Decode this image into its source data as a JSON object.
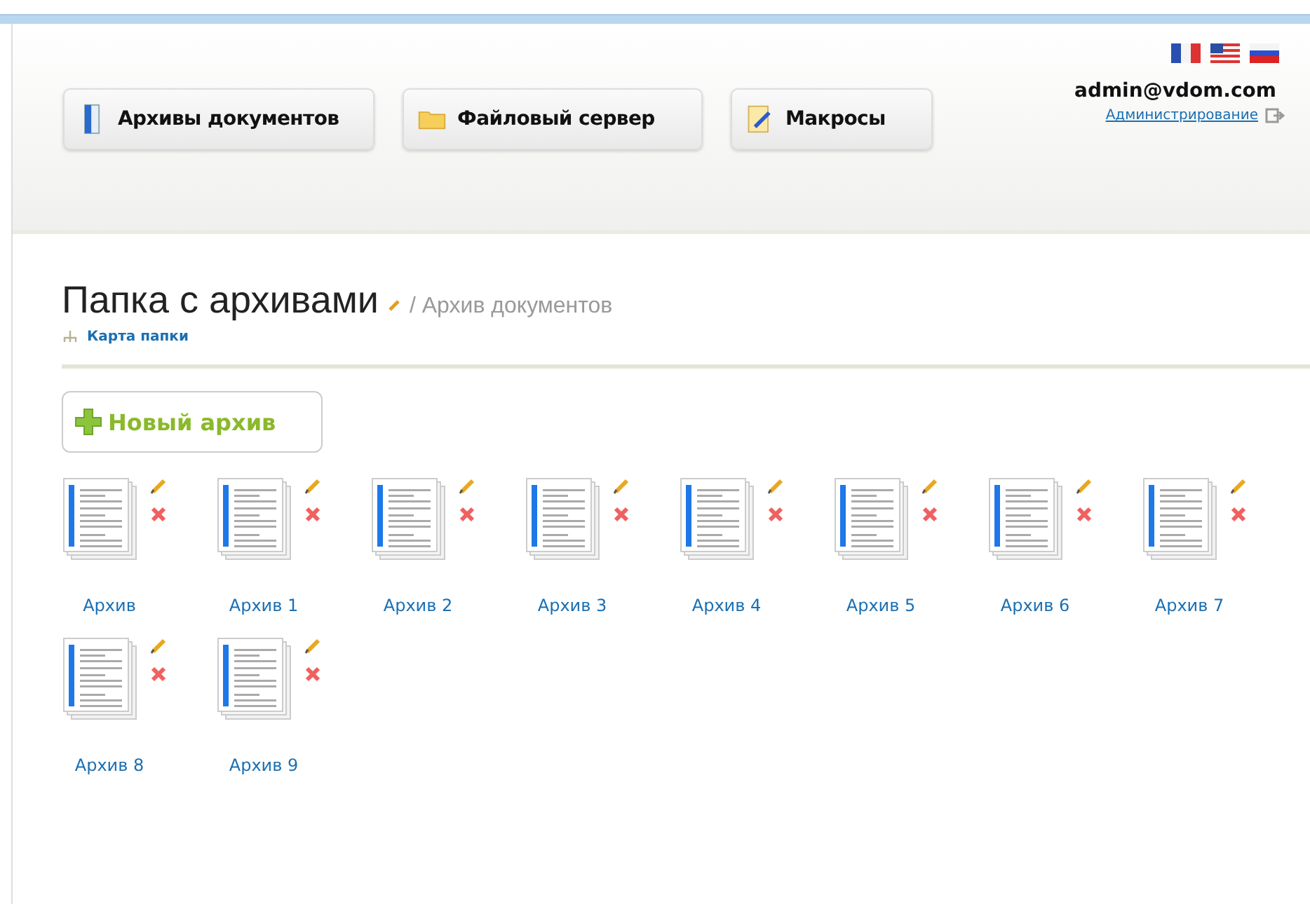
{
  "nav": [
    {
      "label": "Архивы документов",
      "kind": "book"
    },
    {
      "label": "Файловый сервер",
      "kind": "folder"
    },
    {
      "label": "Макросы",
      "kind": "note"
    }
  ],
  "user": {
    "email": "admin@vdom.com",
    "admin_link": "Администрирование"
  },
  "page": {
    "title": "Папка с архивами",
    "breadcrumb": "/ Архив документов",
    "map_link": "Карта папки",
    "new_button": "Новый архив"
  },
  "archives": [
    {
      "label": "Архив"
    },
    {
      "label": "Архив 1"
    },
    {
      "label": "Архив 2"
    },
    {
      "label": "Архив 3"
    },
    {
      "label": "Архив 4"
    },
    {
      "label": "Архив 5"
    },
    {
      "label": "Архив 6"
    },
    {
      "label": "Архив 7"
    },
    {
      "label": "Архив 8"
    },
    {
      "label": "Архив 9"
    }
  ]
}
